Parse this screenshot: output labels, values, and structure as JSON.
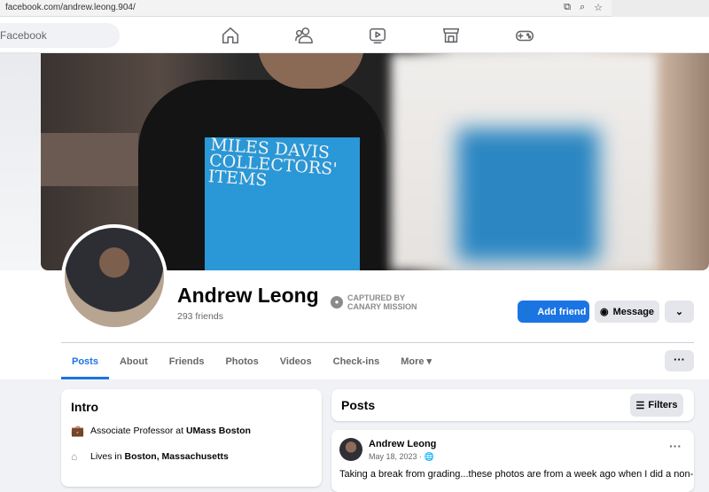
{
  "browser": {
    "url": "facebook.com/andrew.leong.904/"
  },
  "topnav": {
    "search_placeholder": "Facebook",
    "icons": [
      "home-icon",
      "friends-icon",
      "watch-icon",
      "marketplace-icon",
      "gaming-icon"
    ]
  },
  "cover": {
    "shirt_text": "MILES DAVIS\nCOLLECTORS'\nITEMS"
  },
  "profile": {
    "name": "Andrew Leong",
    "friends": "293 friends",
    "badge_line1": "CAPTURED BY",
    "badge_line2": "CANARY MISSION",
    "add_friend": "Add friend",
    "message": "Message"
  },
  "tabs": [
    "Posts",
    "About",
    "Friends",
    "Photos",
    "Videos",
    "Check-ins",
    "More"
  ],
  "intro": {
    "title": "Intro",
    "work_prefix": "Associate Professor at ",
    "work_place": "UMass Boston",
    "lives_prefix": "Lives in ",
    "lives_place": "Boston, Massachusetts"
  },
  "posts": {
    "title": "Posts",
    "filters": "Filters",
    "post": {
      "author": "Andrew Leong",
      "date": "May 18, 2023 · ",
      "text": "Taking a break from grading...these photos are from a week ago when I did a non-"
    }
  },
  "colors": {
    "accent": "#1b74e4",
    "secondary_text": "#65676b",
    "button_gray": "#e4e6eb"
  }
}
